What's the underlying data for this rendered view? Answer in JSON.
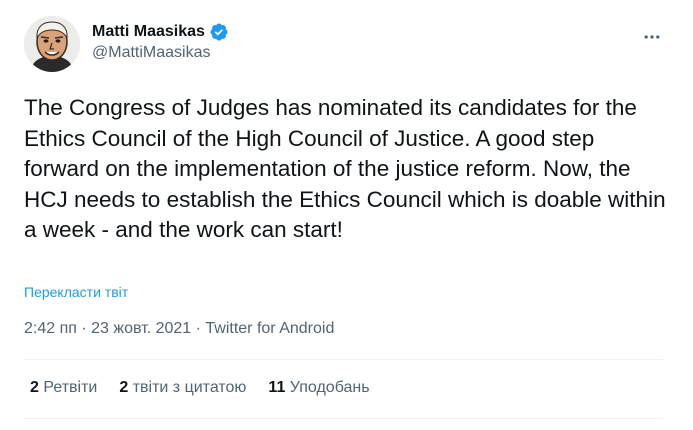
{
  "author": {
    "display_name": "Matti Maasikas",
    "handle": "@MattiMaasikas",
    "verified_icon": "verified-badge-icon",
    "verified_color": "#1d9bf0"
  },
  "more_icon": "more-horizontal-icon",
  "tweet": {
    "text": "The Congress of Judges has nominated its candidates for the Ethics Council of the High Council of Justice. A good step forward on the implementation of the justice reform. Now, the HCJ needs to establish the Ethics Council which is doable within a week - and the work can start!",
    "translate_label": "Перекласти твіт"
  },
  "meta": {
    "time": "2:42 пп",
    "separator": " · ",
    "date": "23 жовт. 2021",
    "source": "Twitter for Android"
  },
  "stats": {
    "retweets_count": "2",
    "retweets_label": "Ретвіти",
    "quotes_count": "2",
    "quotes_label": "твіти з цитатою",
    "likes_count": "11",
    "likes_label": "Уподобань"
  },
  "colors": {
    "text_primary": "#0f1419",
    "text_secondary": "#536471",
    "link": "#1d9bf0",
    "divider": "#eff3f4"
  }
}
